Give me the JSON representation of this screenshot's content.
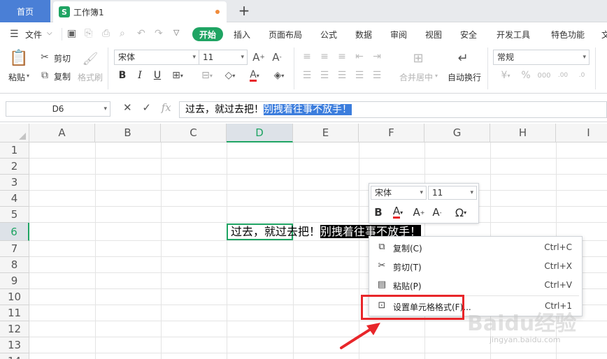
{
  "tabs": {
    "home": "首页",
    "doc_logo": "S",
    "doc_title": "工作簿1",
    "add": "+"
  },
  "menu": {
    "file": "文件",
    "items": [
      "开始",
      "插入",
      "页面布局",
      "公式",
      "数据",
      "审阅",
      "视图",
      "安全",
      "开发工具",
      "特色功能",
      "文"
    ]
  },
  "ribbon": {
    "paste": "粘贴",
    "cut": "剪切",
    "copy": "复制",
    "format_painter": "格式刷",
    "font_name": "宋体",
    "font_size": "11",
    "merge": "合并居中",
    "wrap": "自动换行",
    "number_format": "常规"
  },
  "formula_bar": {
    "name_box": "D6",
    "text_plain": "过去，就过去把！",
    "text_selected": "别拽着往事不放手！"
  },
  "grid": {
    "columns": [
      "A",
      "B",
      "C",
      "D",
      "E",
      "F",
      "G",
      "H",
      "I"
    ],
    "rows": [
      "1",
      "2",
      "3",
      "4",
      "5",
      "6",
      "7",
      "8",
      "9",
      "10",
      "11",
      "12",
      "13",
      "14"
    ],
    "selected_col": "D",
    "selected_row": "6",
    "cell_plain": "过去，就过去把！",
    "cell_selected": "别拽着往事不放手！"
  },
  "mini_toolbar": {
    "font_name": "宋体",
    "font_size": "11"
  },
  "context_menu": [
    {
      "label": "复制(C)",
      "shortcut": "Ctrl+C",
      "icon": "copy-icon"
    },
    {
      "label": "剪切(T)",
      "shortcut": "Ctrl+X",
      "icon": "scissors-icon"
    },
    {
      "label": "粘贴(P)",
      "shortcut": "Ctrl+V",
      "icon": "paste-icon"
    },
    {
      "label": "设置单元格格式(F)...",
      "shortcut": "Ctrl+1",
      "icon": "format-cells-icon"
    }
  ],
  "watermark": {
    "brand": "Baidu经验",
    "url": "jingyan.baidu.com"
  },
  "colors": {
    "accent": "#1fa463",
    "home_tab": "#4a7fd6",
    "highlight": "#3b7ddd",
    "annotation": "#e8262a"
  }
}
